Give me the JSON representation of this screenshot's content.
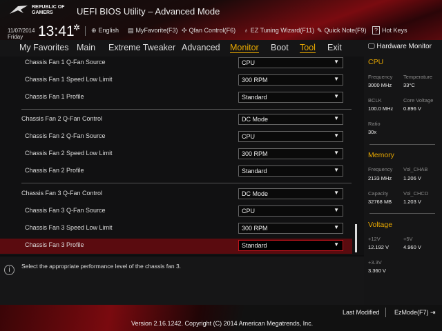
{
  "header": {
    "brand": "REPUBLIC OF GAMERS",
    "title": "UEFI BIOS Utility – Advanced Mode",
    "date": "11/07/2014",
    "day": "Friday",
    "time": "13:41"
  },
  "toolbar": [
    {
      "icon": "globe-icon",
      "glyph": "⊕",
      "label": "English"
    },
    {
      "icon": "favorite-icon",
      "glyph": "▤",
      "label": "MyFavorite(F3)"
    },
    {
      "icon": "fan-icon",
      "glyph": "✣",
      "label": "Qfan Control(F6)"
    },
    {
      "icon": "bulb-icon",
      "glyph": "♁",
      "label": "EZ Tuning Wizard(F11)"
    },
    {
      "icon": "note-icon",
      "glyph": "✎",
      "label": "Quick Note(F9)"
    },
    {
      "icon": "help-icon",
      "glyph": "?",
      "label": "Hot Keys"
    }
  ],
  "tabs": [
    "My Favorites",
    "Main",
    "Extreme Tweaker",
    "Advanced",
    "Monitor",
    "Boot",
    "Tool",
    "Exit"
  ],
  "active_tab": "Monitor",
  "settings": [
    {
      "label": "Chassis Fan 1 Q-Fan Source",
      "value": "CPU"
    },
    {
      "label": "Chassis Fan 1 Speed Low Limit",
      "value": "300 RPM"
    },
    {
      "label": "Chassis Fan 1 Profile",
      "value": "Standard"
    },
    {
      "label": "Chassis Fan 2 Q-Fan Control",
      "value": "DC Mode"
    },
    {
      "label": "Chassis Fan 2 Q-Fan Source",
      "value": "CPU"
    },
    {
      "label": "Chassis Fan 2 Speed Low Limit",
      "value": "300 RPM"
    },
    {
      "label": "Chassis Fan 2 Profile",
      "value": "Standard"
    },
    {
      "label": "Chassis Fan 3 Q-Fan Control",
      "value": "DC Mode"
    },
    {
      "label": "Chassis Fan 3 Q-Fan Source",
      "value": "CPU"
    },
    {
      "label": "Chassis Fan 3 Speed Low Limit",
      "value": "300 RPM"
    },
    {
      "label": "Chassis Fan 3 Profile",
      "value": "Standard"
    }
  ],
  "help": "Select the appropriate performance level of the chassis fan 3.",
  "hw": {
    "title": "Hardware Monitor",
    "cpu": {
      "title": "CPU",
      "freq_l": "Frequency",
      "freq": "3000 MHz",
      "temp_l": "Temperature",
      "temp": "33°C",
      "bclk_l": "BCLK",
      "bclk": "100.0 MHz",
      "cv_l": "Core Voltage",
      "cv": "0.896 V",
      "ratio_l": "Ratio",
      "ratio": "30x"
    },
    "mem": {
      "title": "Memory",
      "freq_l": "Frequency",
      "freq": "2133 MHz",
      "chab_l": "Vol_CHAB",
      "chab": "1.206 V",
      "cap_l": "Capacity",
      "cap": "32768 MB",
      "chcd_l": "Vol_CHCD",
      "chcd": "1.203 V"
    },
    "volt": {
      "title": "Voltage",
      "v12_l": "+12V",
      "v12": "12.192 V",
      "v5_l": "+5V",
      "v5": "4.960 V",
      "v33_l": "+3.3V",
      "v33": "3.360 V"
    }
  },
  "footer": {
    "last_modified": "Last Modified",
    "ezmode": "EzMode(F7)",
    "version": "Version 2.16.1242. Copyright (C) 2014 American Megatrends, Inc."
  }
}
